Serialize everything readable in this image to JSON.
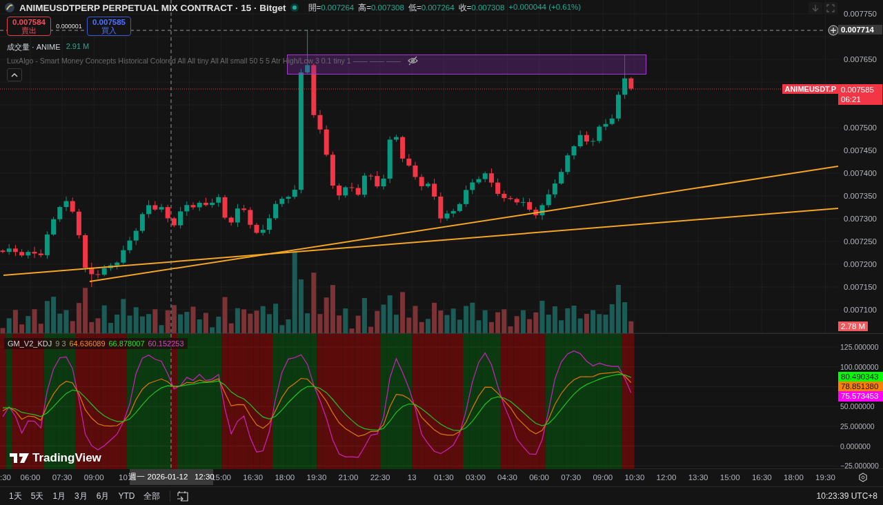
{
  "header": {
    "symbol_title": "ANIMEUSDTPERP PERPETUAL MIX CONTRACT · 15 · Bitget",
    "market_open": true,
    "ohlc": [
      {
        "label": "開=",
        "value": "0.007264"
      },
      {
        "label": "高=",
        "value": "0.007308"
      },
      {
        "label": "低=",
        "value": "0.007264"
      },
      {
        "label": "收=",
        "value": "0.007308"
      }
    ],
    "change": "+0.000044 (+0.61%)"
  },
  "trade_buttons": [
    {
      "kind": "sell",
      "price": "0.007584",
      "label": "賣出"
    },
    {
      "kind": "buy",
      "price": "0.007585",
      "label": "買入"
    }
  ],
  "spread": "0.000001",
  "volume_legend": {
    "label": "成交量 · ANIME",
    "value": "2.91 M"
  },
  "indicator_legend": "LuxAlgo - Smart Money Concepts Historical Colored All All tiny All All small 50 5 5 Atr High/Low 3 0.1 tiny 1 —— —— ——",
  "price_axis": {
    "ticks": [
      "0.007750",
      "0.007650",
      "0.007500",
      "0.007450",
      "0.007400",
      "0.007350",
      "0.007300",
      "0.007250",
      "0.007200",
      "0.007150",
      "0.007100"
    ],
    "crosshair_label": "0.007714",
    "symbol_tag": "ANIMEUSDT.P",
    "last_price": "0.007585",
    "countdown": "06:21",
    "volume_tag": "2.78 M"
  },
  "kdj_pane": {
    "legend": {
      "name": "GM_V2_KDJ",
      "params": "9 3",
      "values": [
        {
          "value": "64.636089",
          "color": "#ff8c1a"
        },
        {
          "value": "66.878007",
          "color": "#33dd33"
        },
        {
          "value": "60.152253",
          "color": "#e040e0"
        }
      ]
    },
    "ticks": [
      "125.000000",
      "100.000000",
      "50.000000",
      "25.000000",
      "0.000000",
      "−25.000000"
    ],
    "value_tags": [
      {
        "value": "80.490343",
        "color": "#00ff00"
      },
      {
        "value": "78.851380",
        "color": "#ff8000"
      },
      {
        "value": "75.573453",
        "color": "#ff00ff"
      }
    ]
  },
  "logo": "TradingView",
  "time_axis": {
    "labels": [
      ":30",
      "06:00",
      "07:30",
      "09:00",
      "10",
      "15:00",
      "16:30",
      "18:00",
      "19:30",
      "21:00",
      "22:30",
      "13",
      "01:30",
      "03:00",
      "04:30",
      "06:00",
      "07:30",
      "09:00",
      "10:30",
      "12:00",
      "13:30",
      "15:00",
      "16:30",
      "18:00",
      "19:30"
    ],
    "crosshair_label": "週一 2026-01-12   12:30"
  },
  "ranges": [
    "1天",
    "5天",
    "1月",
    "3月",
    "6月",
    "YTD",
    "全部"
  ],
  "clock": "10:23:39 UTC+8"
}
